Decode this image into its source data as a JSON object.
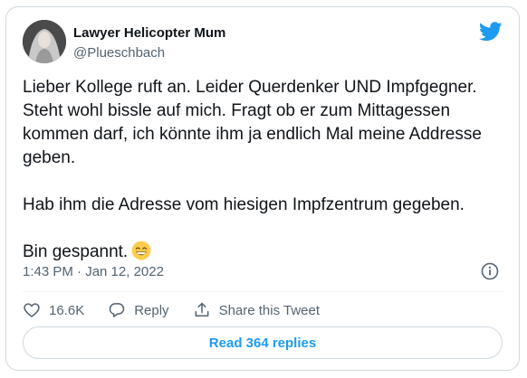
{
  "author": {
    "name": "Lawyer Helicopter Mum",
    "handle": "@Plueschbach"
  },
  "tweet": {
    "paragraph1": "Lieber Kollege ruft an. Leider Querdenker UND Impfgegner. Steht wohl bissle auf mich. Fragt ob er zum Mittagessen kommen darf, ich könnte ihm ja endlich Mal meine Addresse geben.",
    "paragraph2": "Hab ihm die Adresse vom hiesigen Impfzentrum gegeben.",
    "paragraph3": "Bin gespannt.",
    "emoji": "grinning-face-with-smiling-eyes",
    "timestamp": "1:43 PM · Jan 12, 2022"
  },
  "actions": {
    "likes": "16.6K",
    "reply_label": "Reply",
    "share_label": "Share this Tweet"
  },
  "replies_button": "Read 364 replies",
  "colors": {
    "twitter_blue": "#1d9bf0",
    "like_red": "#f91880",
    "muted_text": "#536471",
    "border": "#cfd9de"
  }
}
